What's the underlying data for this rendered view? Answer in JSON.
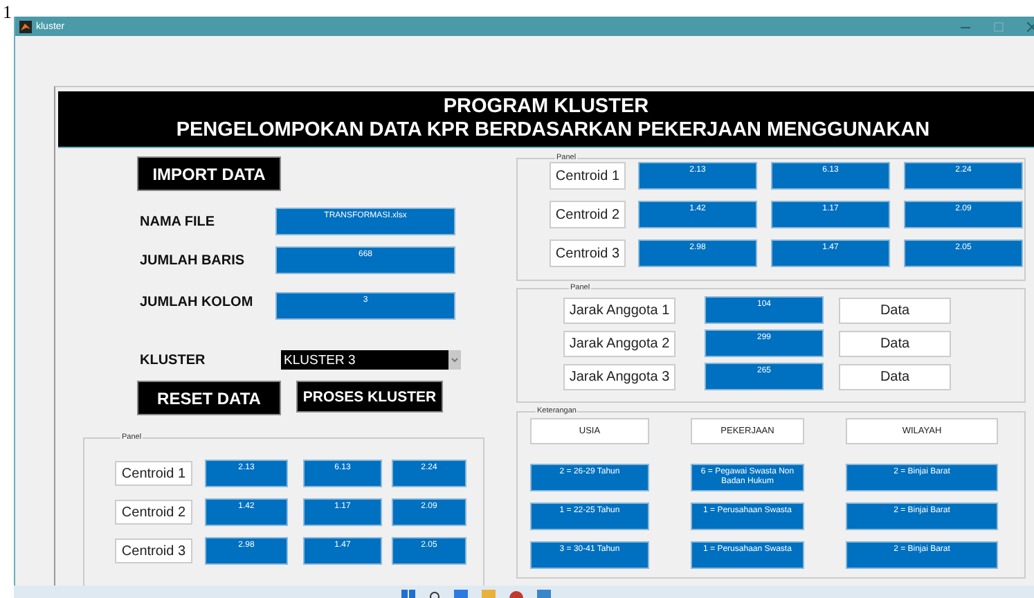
{
  "page_marker": "1",
  "window": {
    "title": "kluster"
  },
  "header": {
    "lines": [
      "PROGRAM KLUSTER",
      "PENGELOMPOKAN DATA KPR BERDASARKAN PEKERJAAN MENGGUNAKAN"
    ]
  },
  "import_button": "IMPORT DATA",
  "fields": [
    {
      "label": "NAMA FILE",
      "value": "TRANSFORMASI.xlsx"
    },
    {
      "label": "JUMLAH BARIS",
      "value": "668"
    },
    {
      "label": "JUMLAH KOLOM",
      "value": "3"
    }
  ],
  "kluster": {
    "label": "KLUSTER",
    "value": "KLUSTER 3"
  },
  "buttons": [
    "RESET DATA",
    "PROSES KLUSTER"
  ],
  "left_panel": {
    "title": "Panel",
    "rows": [
      {
        "label": "Centroid 1",
        "values": [
          "2.13",
          "6.13",
          "2.24"
        ]
      },
      {
        "label": "Centroid 2",
        "values": [
          "1.42",
          "1.17",
          "2.09"
        ]
      },
      {
        "label": "Centroid 3",
        "values": [
          "2.98",
          "1.47",
          "2.05"
        ]
      }
    ]
  },
  "centroid_panel": {
    "title": "Panel",
    "rows": [
      {
        "label": "Centroid 1",
        "values": [
          "2.13",
          "6.13",
          "2.24"
        ]
      },
      {
        "label": "Centroid 2",
        "values": [
          "1.42",
          "1.17",
          "2.09"
        ]
      },
      {
        "label": "Centroid 3",
        "values": [
          "2.98",
          "1.47",
          "2.05"
        ]
      }
    ]
  },
  "distance_panel": {
    "title": "Panel",
    "rows": [
      {
        "label": "Jarak Anggota 1",
        "value": "104",
        "button": "Data"
      },
      {
        "label": "Jarak Anggota 2",
        "value": "299",
        "button": "Data"
      },
      {
        "label": "Jarak Anggota 3",
        "value": "265",
        "button": "Data"
      }
    ]
  },
  "legend": {
    "title": "Keterangan",
    "columns": [
      "USIA",
      "PEKERJAAN",
      "WILAYAH"
    ],
    "rows": [
      [
        "2 = 26-29 Tahun",
        "6 = Pegawai Swasta Non Badan Hukum",
        "2 = Binjai Barat"
      ],
      [
        "1 = 22-25 Tahun",
        "1 = Perusahaan Swasta",
        "2 = Binjai Barat"
      ],
      [
        "3 = 30-41 Tahun",
        "1 = Perusahaan Swasta",
        "2 = Binjai Barat"
      ]
    ]
  }
}
